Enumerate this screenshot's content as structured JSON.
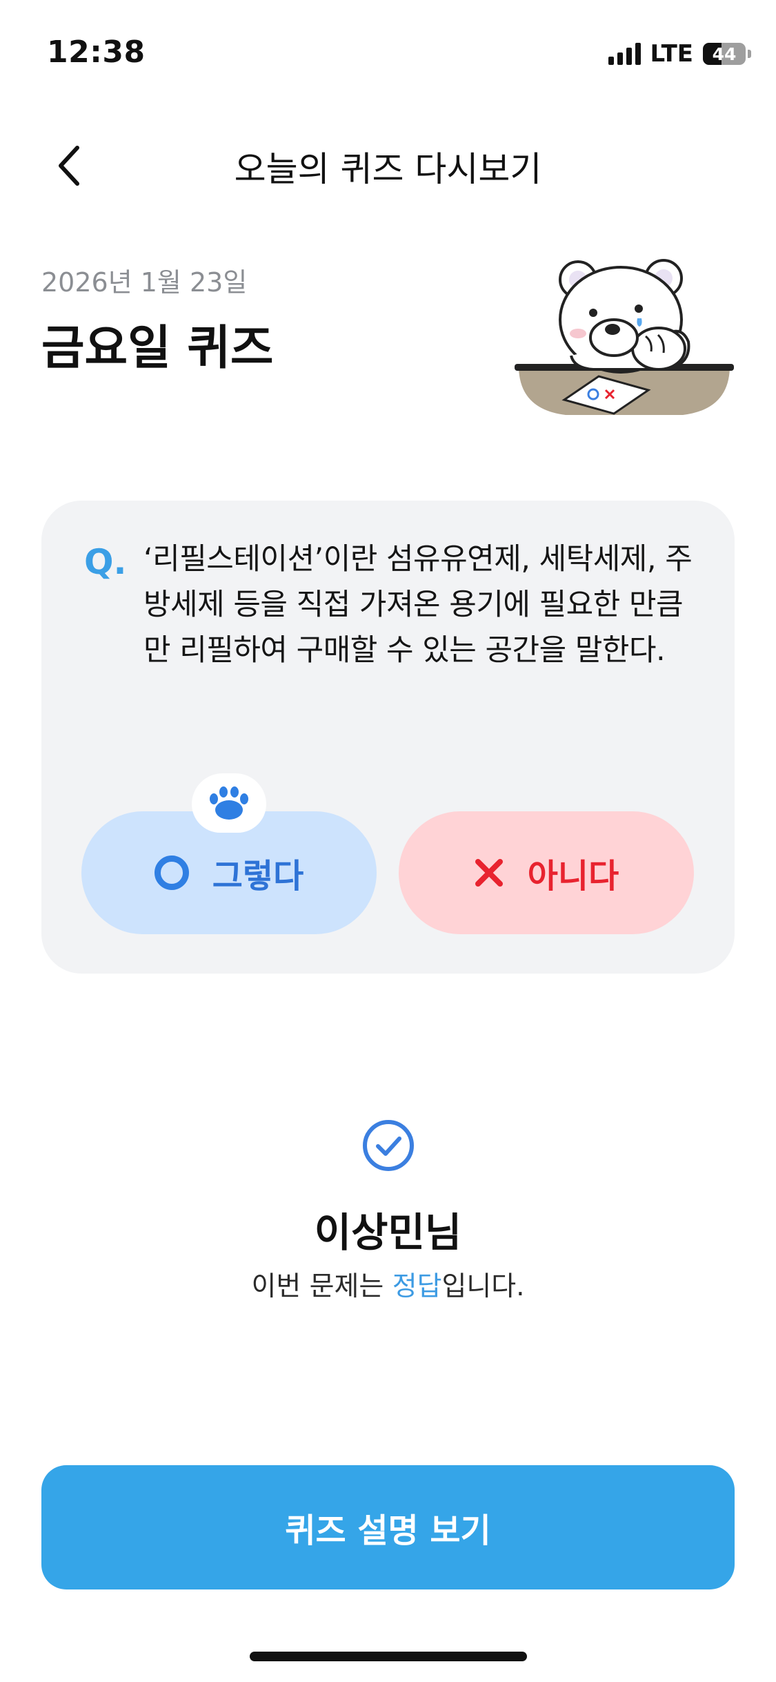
{
  "status_bar": {
    "time": "12:38",
    "network": "LTE",
    "battery": "44",
    "battery_level_percent": 44
  },
  "header": {
    "back_icon": "chevron-left-icon",
    "title": "오늘의 퀴즈 다시보기"
  },
  "quiz": {
    "date": "2026년 1월 23일",
    "title": "금요일 퀴즈",
    "question_label": "Q.",
    "question_text": "‘리필스테이션’이란 섬유유연제, 세탁세제, 주방세제 등을 직접 가져온 용기에 필요한 만큼만 리필하여 구매할 수 있는 공간을 말한다.",
    "answers": {
      "yes_label": "그렇다",
      "no_label": "아니다",
      "selected": "yes"
    }
  },
  "result": {
    "user_name": "이상민님",
    "line_prefix": "이번 문제는 ",
    "line_highlight": "정답",
    "line_suffix": "입니다."
  },
  "actions": {
    "explain_button": "퀴즈 설명 보기"
  },
  "colors": {
    "accent_blue": "#35a5e8",
    "yes_bg": "#cde3fd",
    "no_bg": "#ffd3d6",
    "no_text": "#e8232f",
    "card_bg": "#f2f3f5"
  }
}
